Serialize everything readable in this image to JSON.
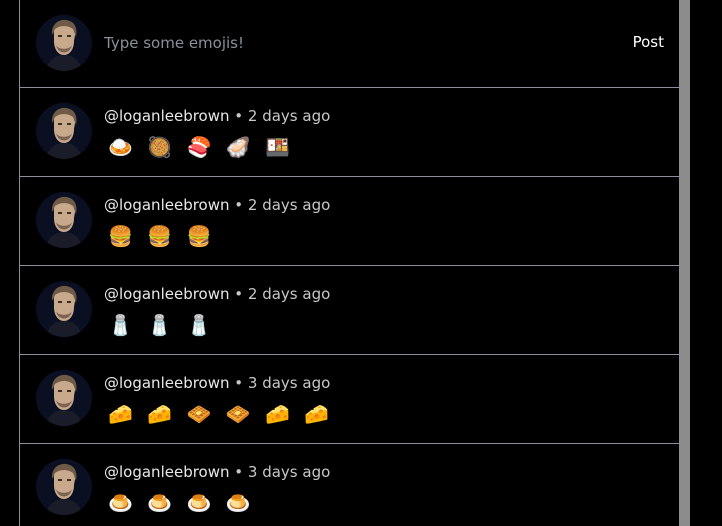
{
  "composer": {
    "placeholder": "Type some emojis!",
    "post_label": "Post"
  },
  "posts": [
    {
      "handle": "@loganleebrown",
      "separator": " • ",
      "time": "2 days ago",
      "emojis": "🍛 🥘 🍣 🦪 🍱"
    },
    {
      "handle": "@loganleebrown",
      "separator": " • ",
      "time": "2 days ago",
      "emojis": "🍔 🍔 🍔"
    },
    {
      "handle": "@loganleebrown",
      "separator": " • ",
      "time": "2 days ago",
      "emojis": "🧂 🧂 🧂"
    },
    {
      "handle": "@loganleebrown",
      "separator": " • ",
      "time": "3 days ago",
      "emojis": "🧀 🧀 🧇 🧇 🧀 🧀"
    },
    {
      "handle": "@loganleebrown",
      "separator": " • ",
      "time": "3 days ago",
      "emojis": "🍮 🍮 🍮 🍮"
    }
  ]
}
